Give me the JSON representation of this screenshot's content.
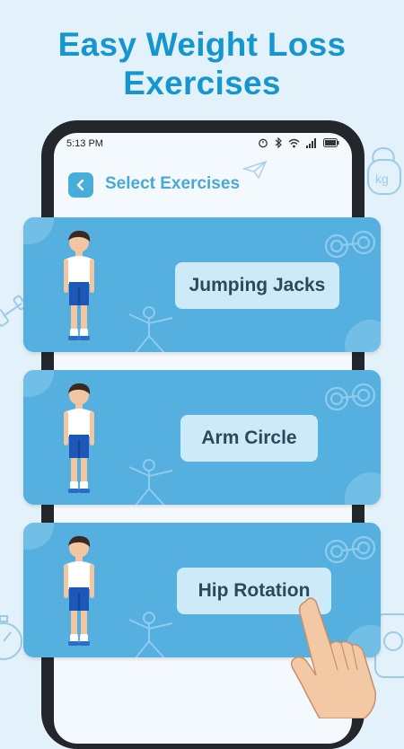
{
  "headline": {
    "line1": "Easy Weight Loss",
    "line2": "Exercises"
  },
  "status_bar": {
    "time": "5:13 PM"
  },
  "screen": {
    "title": "Select Exercises"
  },
  "exercises": [
    {
      "label": "Jumping Jacks"
    },
    {
      "label": "Arm Circle"
    },
    {
      "label": "Hip Rotation"
    }
  ],
  "colors": {
    "accent": "#1596cf",
    "card": "#55afdf",
    "label_bg": "#cdeaf8",
    "back_button": "#47aedc"
  },
  "icons": [
    "back-arrow-icon",
    "alarm-icon",
    "bluetooth-icon",
    "wifi-icon",
    "signal-icon",
    "battery-icon",
    "dumbbell-icon",
    "kettlebell-icon",
    "paper-plane-icon",
    "stopwatch-icon",
    "scale-icon",
    "pointing-hand-icon"
  ]
}
